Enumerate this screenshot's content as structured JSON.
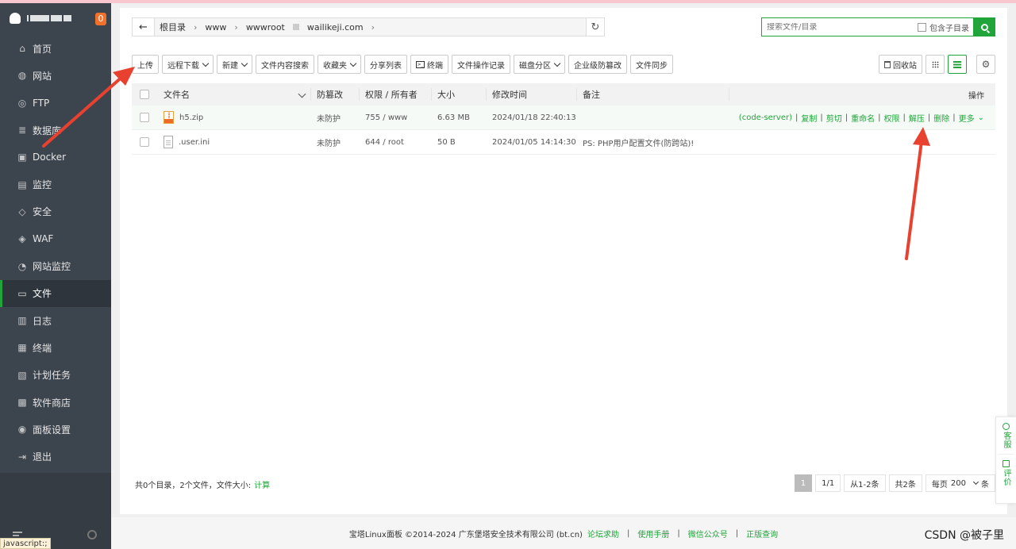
{
  "sidebar": {
    "badge": "0",
    "items": [
      {
        "label": "首页",
        "icon": "home-icon"
      },
      {
        "label": "网站",
        "icon": "globe-icon"
      },
      {
        "label": "FTP",
        "icon": "ftp-icon"
      },
      {
        "label": "数据库",
        "icon": "database-icon"
      },
      {
        "label": "Docker",
        "icon": "docker-icon"
      },
      {
        "label": "监控",
        "icon": "monitor-icon"
      },
      {
        "label": "安全",
        "icon": "shield-icon"
      },
      {
        "label": "WAF",
        "icon": "waf-icon"
      },
      {
        "label": "网站监控",
        "icon": "site-monitor-icon"
      },
      {
        "label": "文件",
        "icon": "folder-icon"
      },
      {
        "label": "日志",
        "icon": "log-icon"
      },
      {
        "label": "终端",
        "icon": "terminal-icon"
      },
      {
        "label": "计划任务",
        "icon": "task-icon"
      },
      {
        "label": "软件商店",
        "icon": "store-icon"
      },
      {
        "label": "面板设置",
        "icon": "settings-icon"
      },
      {
        "label": "退出",
        "icon": "logout-icon"
      }
    ],
    "active_index": 9,
    "status_text": "javascript:;"
  },
  "address": {
    "root": "根目录",
    "seg1": "www",
    "seg2": "wwwroot",
    "seg3": "wailikeji.com"
  },
  "search": {
    "placeholder": "搜索文件/目录",
    "include_sub_label": "包含子目录"
  },
  "toolbar": {
    "upload": "上传",
    "remote_download": "远程下载",
    "new": "新建",
    "content_search": "文件内容搜索",
    "favorites": "收藏夹",
    "share_list": "分享列表",
    "terminal": "终端",
    "op_log": "文件操作记录",
    "disk_partition": "磁盘分区",
    "enterprise_tamper": "企业级防篡改",
    "file_sync": "文件同步",
    "recycle_bin": "回收站"
  },
  "table": {
    "headers": {
      "name": "文件名",
      "tamper": "防篡改",
      "perm": "权限 / 所有者",
      "size": "大小",
      "mtime": "修改时间",
      "remark": "备注",
      "ops": "操作"
    },
    "rows": [
      {
        "name": "h5.zip",
        "tamper": "未防护",
        "perm": "755 / www",
        "size": "6.63 MB",
        "mtime": "2024/01/18 22:40:13",
        "remark": ""
      },
      {
        "name": ".user.ini",
        "tamper": "未防护",
        "perm": "644 / root",
        "size": "50 B",
        "mtime": "2024/01/05 14:14:30",
        "remark": "PS: PHP用户配置文件(防跨站)!"
      }
    ],
    "row_ops": {
      "code_server": "(code-server)",
      "copy": "复制",
      "cut": "剪切",
      "rename": "重命名",
      "perm": "权限",
      "unzip": "解压",
      "delete": "删除",
      "more": "更多"
    }
  },
  "summary": {
    "text": "共0个目录，2个文件，文件大小:",
    "calc_link": "计算"
  },
  "pager": {
    "current": "1",
    "total_pages": "1/1",
    "range": "从1-2条",
    "total": "共2条",
    "per_page_label": "每页",
    "per_page_value": "200",
    "unit": "条"
  },
  "page_footer": {
    "copyright": "宝塔Linux面板 ©2014-2024 广东堡塔安全技术有限公司 (bt.cn)",
    "links": [
      "论坛求助",
      "使用手册",
      "微信公众号",
      "正版查询"
    ]
  },
  "float_panel": {
    "support": "客服",
    "feedback": "评价"
  },
  "watermark": "CSDN @被子里",
  "colors": {
    "accent": "#20a53a",
    "sidebar": "#3c444d",
    "annotation_arrow": "#e8412f"
  }
}
